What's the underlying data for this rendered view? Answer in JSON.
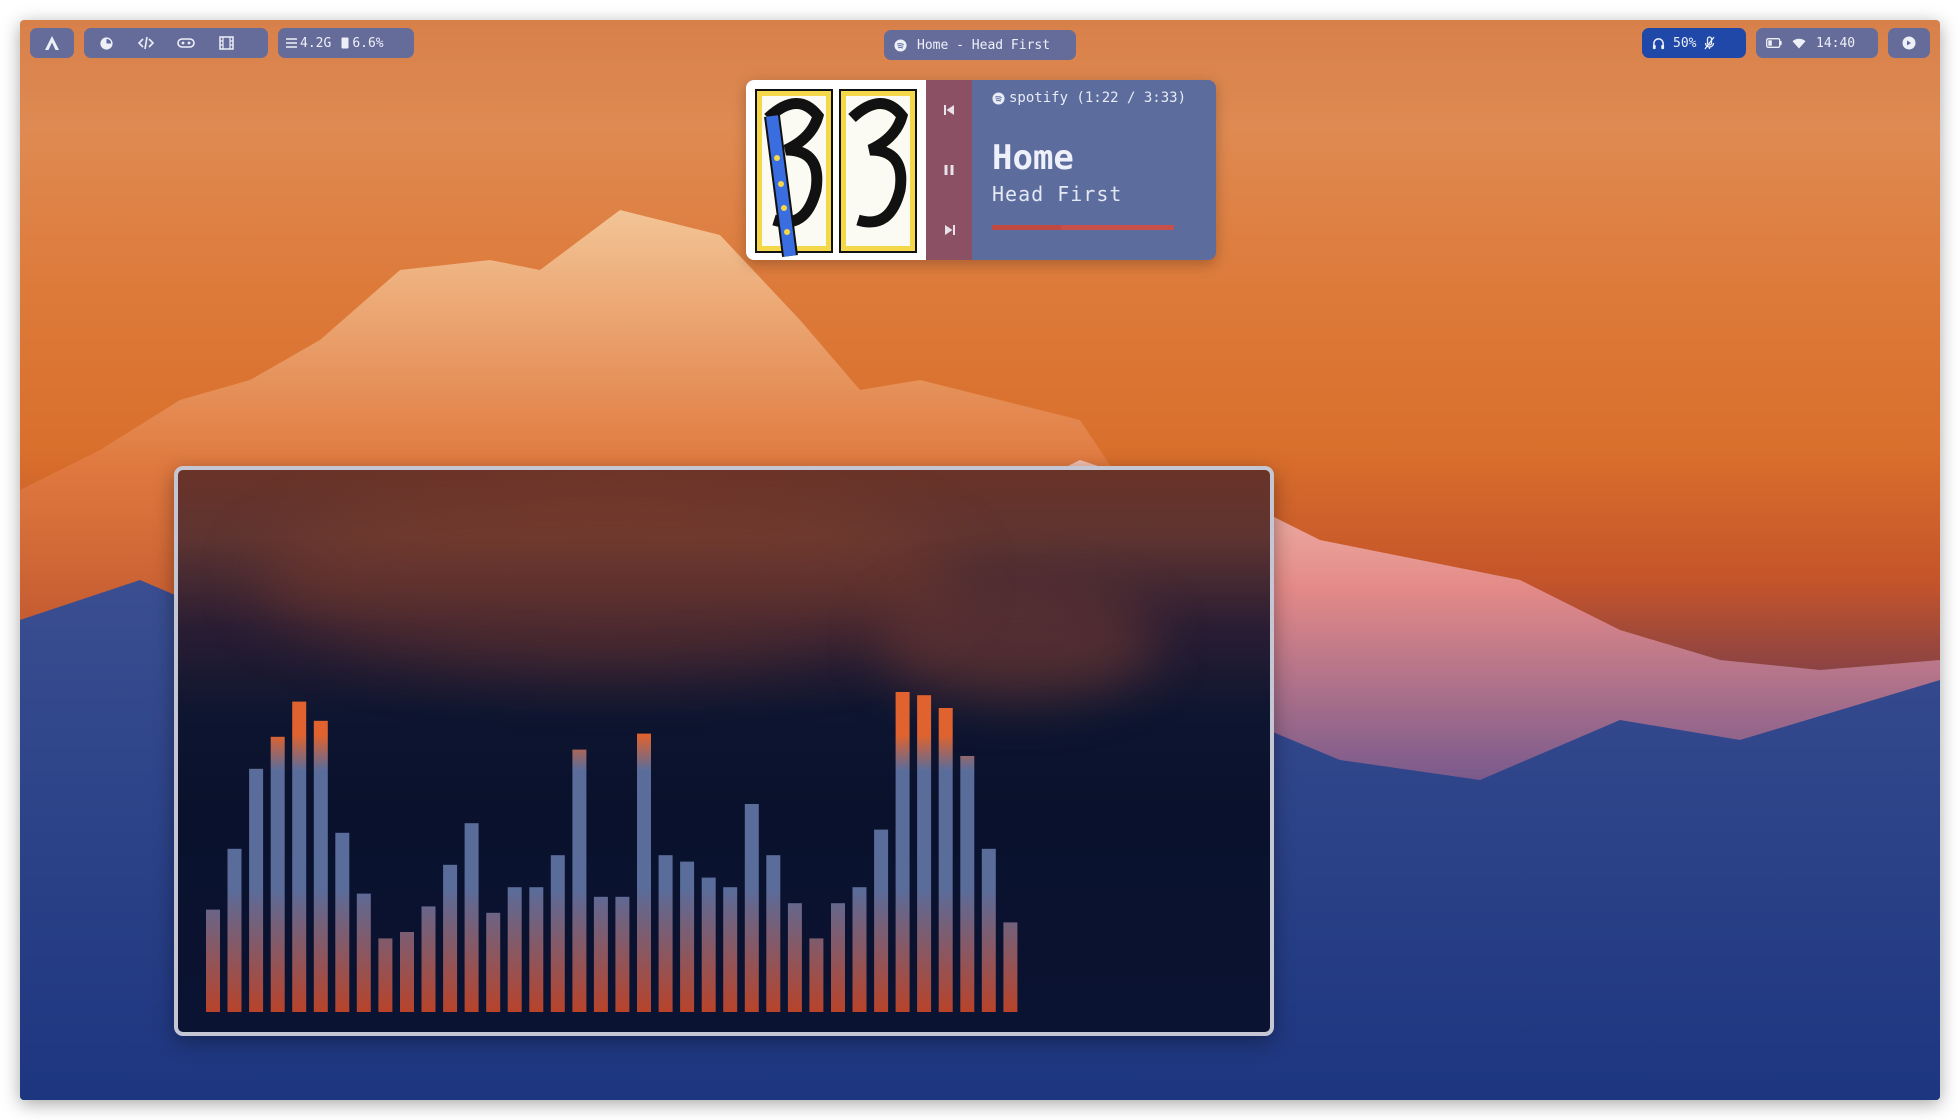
{
  "topbar": {
    "launcher_icon": "arch-logo-icon",
    "apps": [
      "firefox-icon",
      "code-icon",
      "gamepad-icon",
      "film-icon"
    ],
    "stats": {
      "memory": "4.2G",
      "disk": "6.6%"
    },
    "window_title": "Home - Head First",
    "audio": {
      "volume": "50%"
    },
    "clock": "14:40"
  },
  "player": {
    "source": "spotify (1:22 / 3:33)",
    "title": "Home",
    "artist": "Head First",
    "progress": 0.38
  },
  "visualizer": {
    "levels": [
      0.32,
      0.51,
      0.76,
      0.86,
      0.97,
      0.91,
      0.56,
      0.37,
      0.23,
      0.25,
      0.33,
      0.46,
      0.59,
      0.31,
      0.39,
      0.39,
      0.49,
      0.82,
      0.36,
      0.36,
      0.87,
      0.49,
      0.47,
      0.42,
      0.39,
      0.65,
      0.49,
      0.34,
      0.23,
      0.34,
      0.39,
      0.57,
      1.0,
      0.99,
      0.95,
      0.8,
      0.51,
      0.28
    ]
  },
  "colors": {
    "bar_top": "#e0622e",
    "bar_mid": "#5a6c9a",
    "bar_bottom": "#b8432a",
    "accent": "#1f48a8"
  }
}
